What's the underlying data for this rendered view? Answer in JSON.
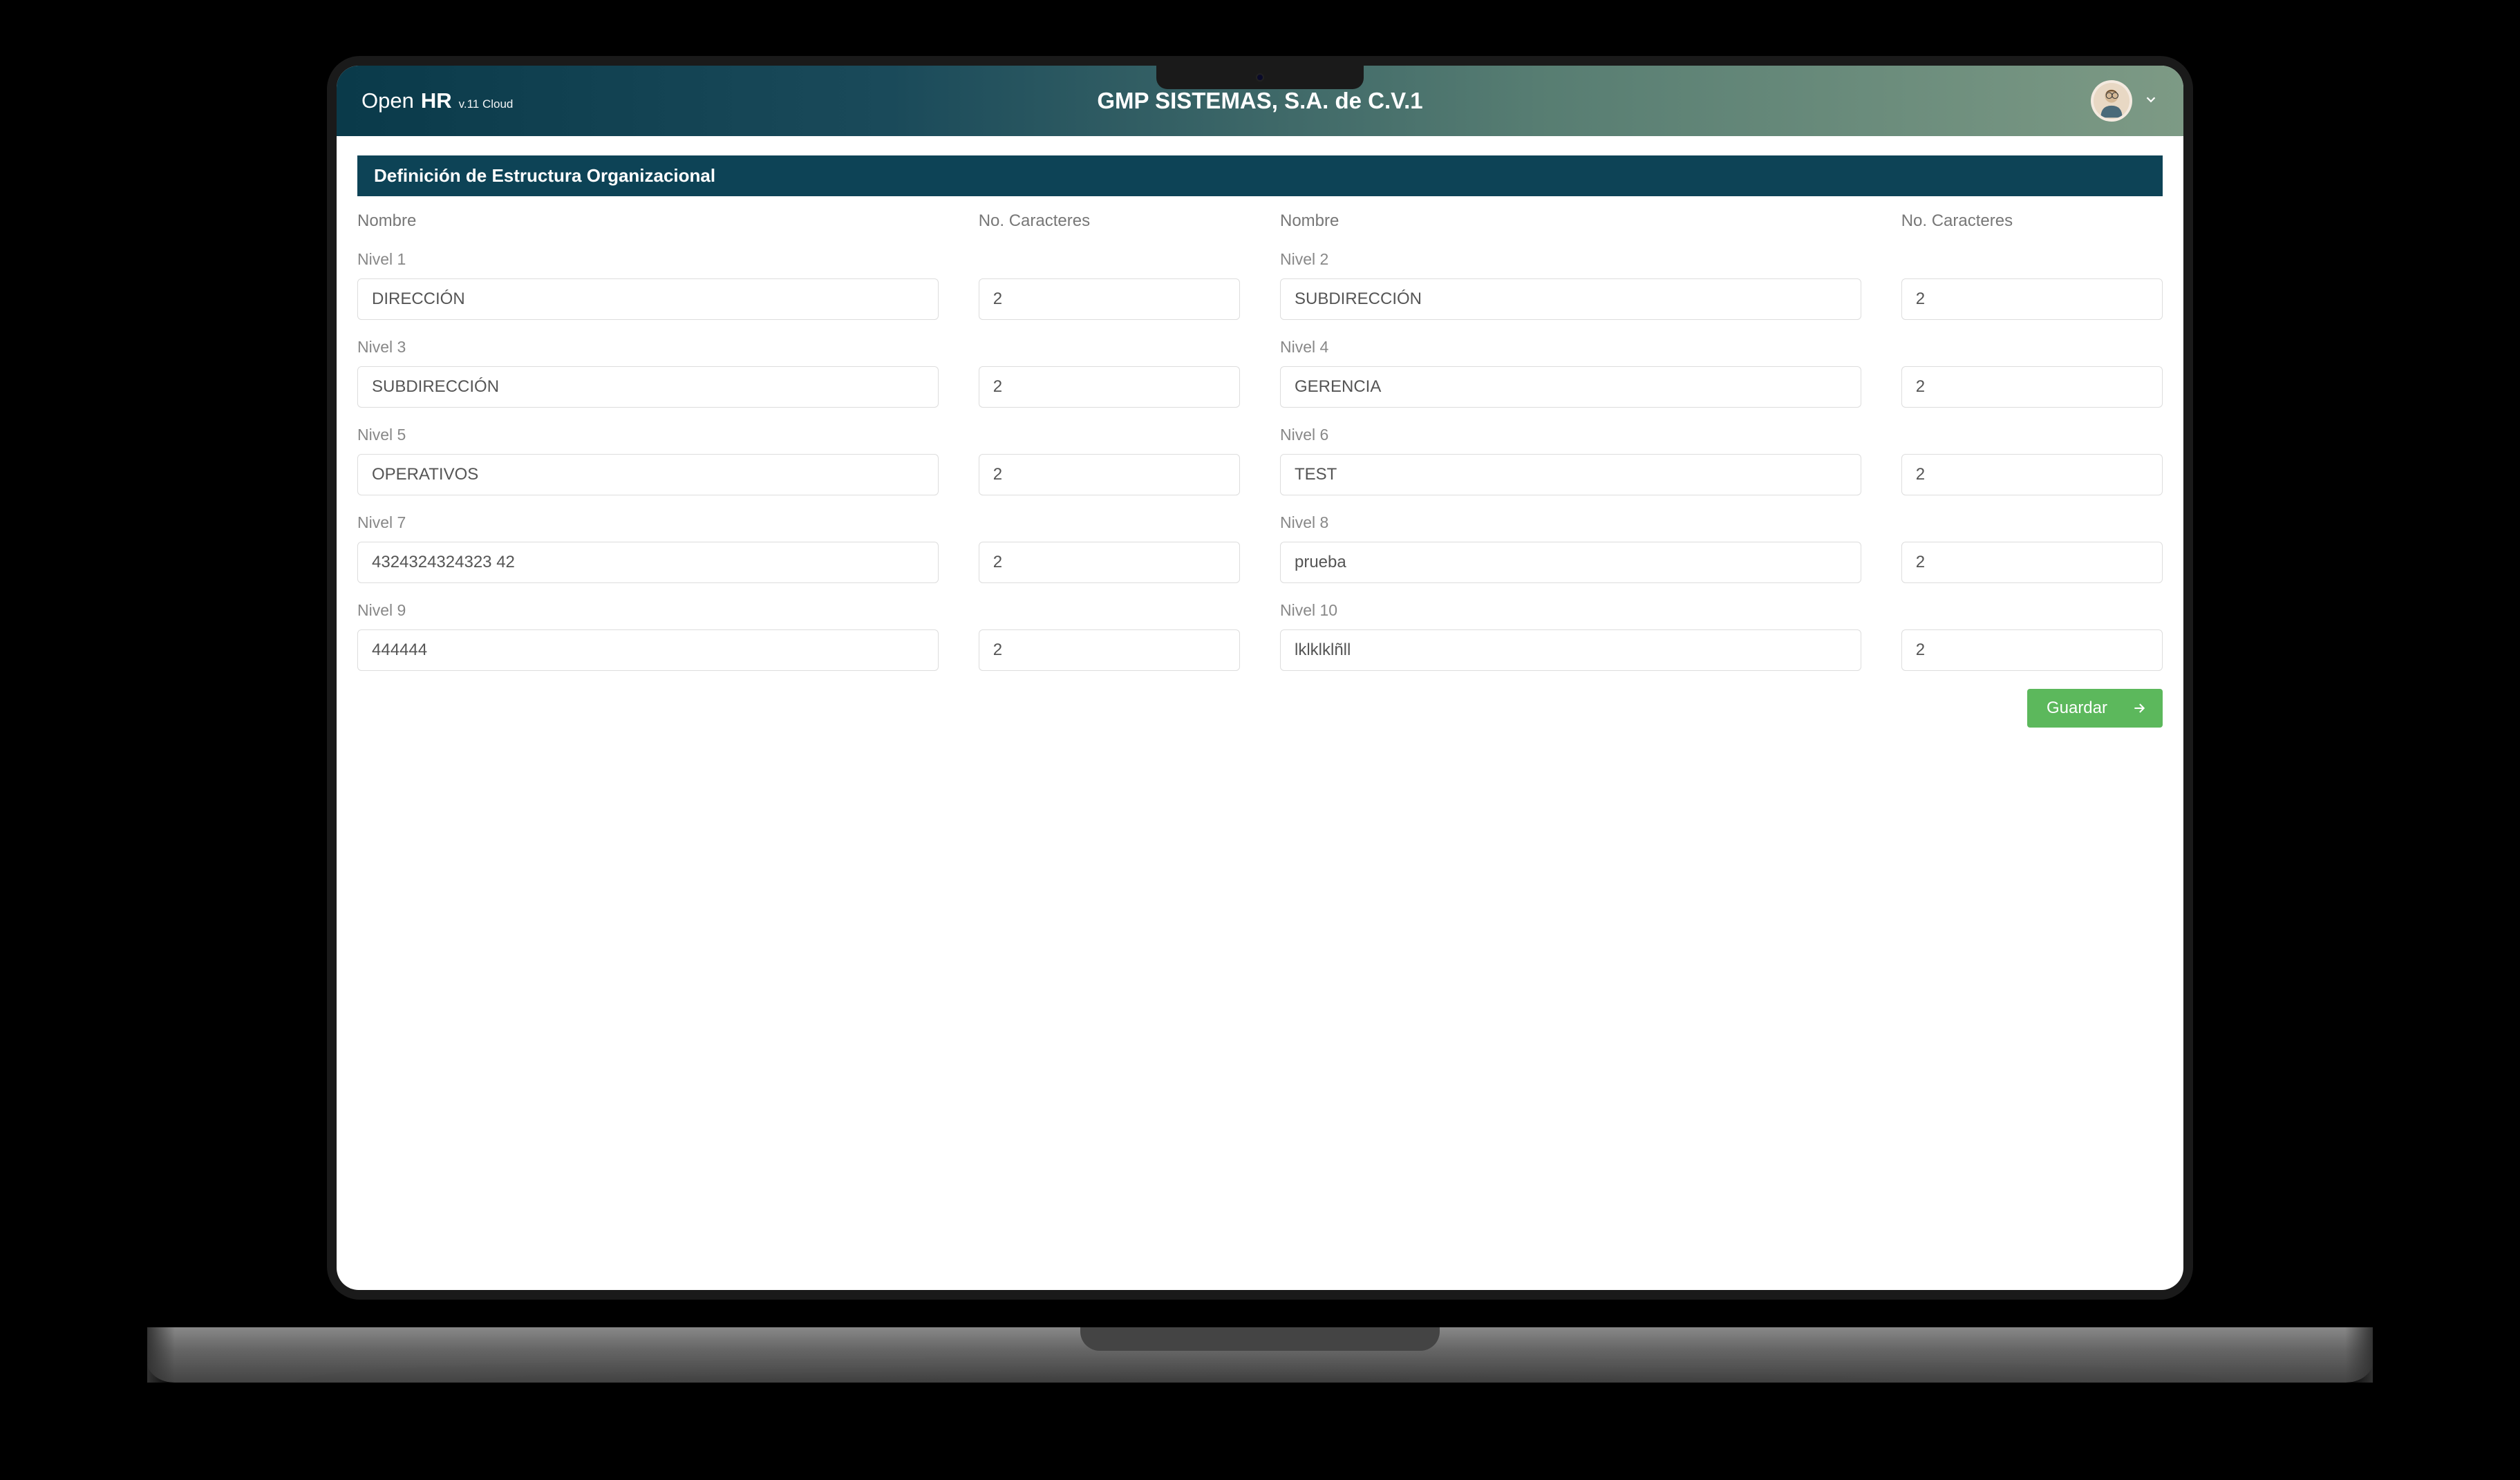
{
  "header": {
    "logo_open": "Open",
    "logo_hr": "HR",
    "logo_version": "v.11 Cloud",
    "company_title": "GMP SISTEMAS, S.A. de C.V.1"
  },
  "panel": {
    "title": "Definición de Estructura Organizacional"
  },
  "column_headers": {
    "name_left": "Nombre",
    "chars_left": "No. Caracteres",
    "name_right": "Nombre",
    "chars_right": "No. Caracteres"
  },
  "levels": [
    {
      "label": "Nivel 1",
      "name": "DIRECCIÓN",
      "chars": "2"
    },
    {
      "label": "Nivel 2",
      "name": "SUBDIRECCIÓN",
      "chars": "2"
    },
    {
      "label": "Nivel 3",
      "name": "SUBDIRECCIÓN",
      "chars": "2"
    },
    {
      "label": "Nivel 4",
      "name": "GERENCIA",
      "chars": "2"
    },
    {
      "label": "Nivel 5",
      "name": "OPERATIVOS",
      "chars": "2"
    },
    {
      "label": "Nivel 6",
      "name": "TEST",
      "chars": "2"
    },
    {
      "label": "Nivel 7",
      "name": "4324324324323 42",
      "chars": "2"
    },
    {
      "label": "Nivel 8",
      "name": "prueba",
      "chars": "2"
    },
    {
      "label": "Nivel 9",
      "name": "444444",
      "chars": "2"
    },
    {
      "label": "Nivel 10",
      "name": "lklklklñll",
      "chars": "2"
    }
  ],
  "buttons": {
    "save": "Guardar"
  }
}
